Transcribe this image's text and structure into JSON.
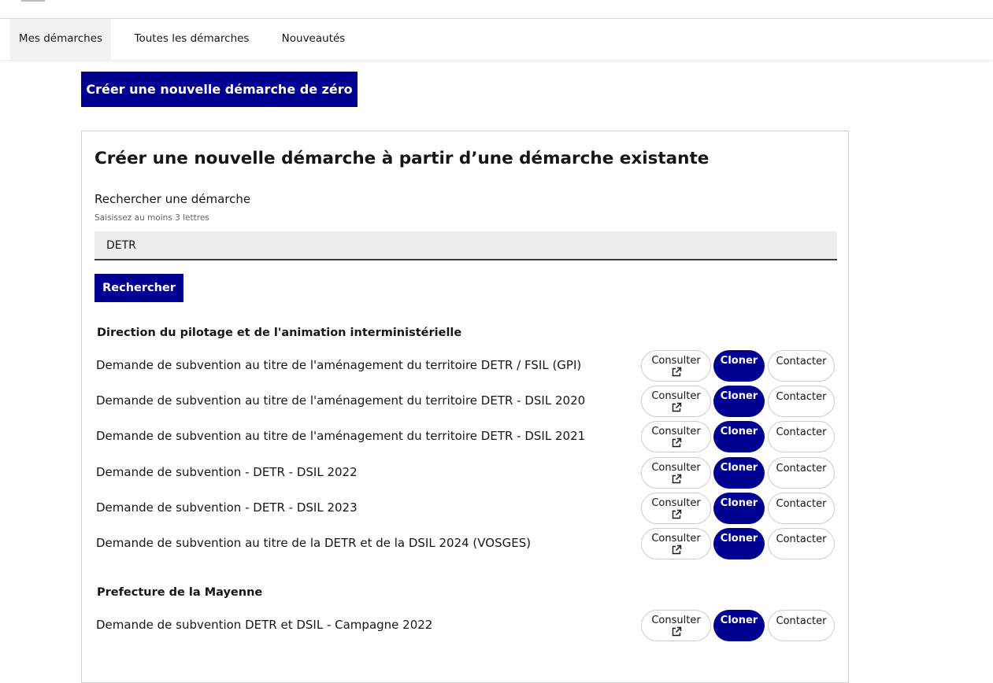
{
  "nav": {
    "items": [
      {
        "label": "Mes démarches",
        "active": true
      },
      {
        "label": "Toutes les démarches",
        "active": false
      },
      {
        "label": "Nouveautés",
        "active": false
      }
    ]
  },
  "create_scratch_button": "Créer une nouvelle démarche de zéro",
  "card": {
    "title": "Créer une nouvelle démarche à partir d’une démarche existante",
    "search": {
      "label": "Rechercher une démarche",
      "hint": "Saisissez au moins 3 lettres",
      "value": "DETR",
      "button": "Rechercher"
    },
    "actions": {
      "consult": "Consulter",
      "clone": "Cloner",
      "contact": "Contacter"
    },
    "groups": [
      {
        "organisation": "Direction du pilotage et de l'animation interministérielle",
        "procedures": [
          "Demande de subvention au titre de l'aménagement du territoire DETR / FSIL (GPI)",
          "Demande de subvention au titre de l'aménagement du territoire DETR - DSIL 2020",
          "Demande de subvention au titre de l'aménagement du territoire DETR - DSIL 2021",
          "Demande de subvention - DETR - DSIL 2022",
          "Demande de subvention - DETR - DSIL 2023",
          "Demande de subvention au titre de la DETR et de la DSIL 2024 (VOSGES)"
        ]
      },
      {
        "organisation": "Prefecture de la Mayenne",
        "procedures": [
          "Demande de subvention DETR et DSIL - Campagne 2022"
        ]
      }
    ]
  },
  "colors": {
    "primary": "#000091",
    "text": "#161616",
    "input_bg": "#eeeeee",
    "nav_active_bg": "#f2f2f2"
  },
  "icons": {
    "external_link": "external-link-icon"
  }
}
